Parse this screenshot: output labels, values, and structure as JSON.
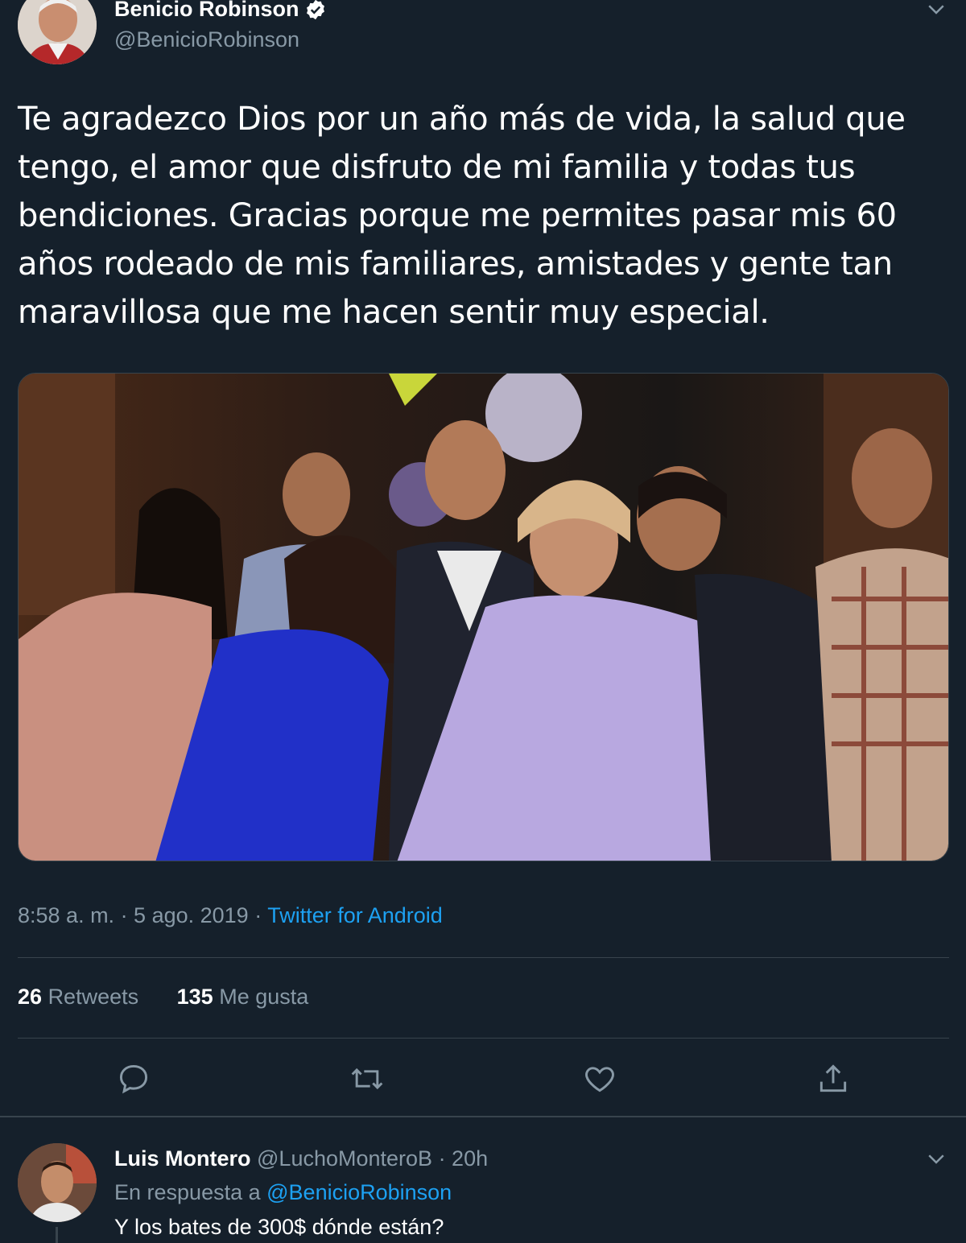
{
  "tweet": {
    "author_name": "Benicio Robinson",
    "author_handle": "@BenicioRobinson",
    "text_lines": [
      "Te agradezco Dios por un año más de vida, la salud que",
      "tengo, el amor que disfruto de mi familia y todas tus",
      "bendiciones.  Gracias porque me permites pasar mis 60",
      "años rodeado de mis familiares, amistades y gente tan",
      "maravillosa que me hacen sentir muy especial."
    ],
    "timestamp": "8:58 a. m. · 5 ago. 2019",
    "separator": " · ",
    "source": "Twitter for Android",
    "retweets_count": "26",
    "retweets_label": "Retweets",
    "likes_count": "135",
    "likes_label": "Me gusta"
  },
  "reply": {
    "author_name": "Luis Montero",
    "author_handle": "@LuchoMonteroB",
    "time": "· 20h",
    "in_reply_prefix": "En respuesta a",
    "in_reply_mention": "@BenicioRobinson",
    "text": "Y los bates de 300$ dónde están?"
  },
  "icons": {
    "verified": "verified-badge-icon",
    "caret": "chevron-down-icon",
    "reply": "reply-icon",
    "retweet": "retweet-icon",
    "like": "heart-icon",
    "share": "share-icon"
  },
  "colors": {
    "background": "#15202b",
    "accent": "#1da1f2",
    "muted": "#8899a6",
    "border": "#38444d"
  }
}
